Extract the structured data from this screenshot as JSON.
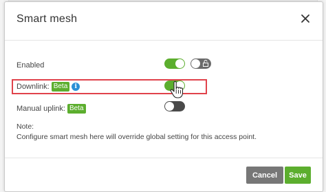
{
  "dialog": {
    "title": "Smart mesh",
    "close_icon": "close-icon"
  },
  "rows": {
    "enabled": {
      "label": "Enabled",
      "toggle_state": "on",
      "lock_toggle_state": "off",
      "lock_icon": "unlock-icon"
    },
    "downlink": {
      "label": "Downlink:",
      "badge": "Beta",
      "info_icon": "info-icon",
      "info_glyph": "i",
      "toggle_state": "on"
    },
    "manual_uplink": {
      "label": "Manual uplink:",
      "badge": "Beta",
      "toggle_state": "off"
    }
  },
  "note": {
    "heading": "Note:",
    "text": "Configure smart mesh here will override global setting for this access point."
  },
  "buttons": {
    "cancel": "Cancel",
    "save": "Save"
  },
  "colors": {
    "accent": "#5cae2e",
    "highlight": "#e0424b",
    "info": "#2b8fd6"
  }
}
